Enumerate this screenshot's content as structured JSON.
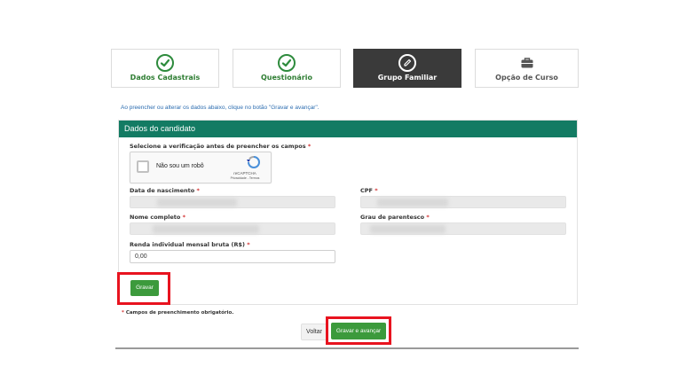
{
  "steps": [
    {
      "label": "Dados Cadastrais",
      "state": "done",
      "icon": "check-circle-icon"
    },
    {
      "label": "Questionário",
      "state": "done",
      "icon": "check-circle-icon"
    },
    {
      "label": "Grupo Familiar",
      "state": "active",
      "icon": "pencil-circle-icon"
    },
    {
      "label": "Opção de Curso",
      "state": "todo",
      "icon": "briefcase-icon"
    }
  ],
  "hint": "Ao preencher ou alterar os dados abaixo, clique no botão \"Gravar e avançar\".",
  "card": {
    "title": "Dados do candidato",
    "captcha_label": "Selecione a verificação antes de preencher os campos",
    "captcha": {
      "text": "Não sou um robô",
      "brand": "reCAPTCHA",
      "links": "Privacidade - Termos"
    },
    "fields": {
      "birth_date": "Data de nascimento",
      "cpf": "CPF",
      "full_name": "Nome completo",
      "kinship": "Grau de parentesco",
      "income": "Renda individual mensal bruta (R$)"
    },
    "income_value": "0,00",
    "required_mark": "*",
    "save_button": "Gravar"
  },
  "footer": {
    "note": "Campos de preenchimento obrigatório.",
    "back_button": "Voltar",
    "save_next_button": "Gravar e avançar"
  },
  "colors": {
    "header_teal": "#137b63",
    "button_green": "#3c9a3c",
    "highlight_red": "#e8131f",
    "active_step": "#3a3a3a",
    "link_blue": "#2b6cb0"
  }
}
